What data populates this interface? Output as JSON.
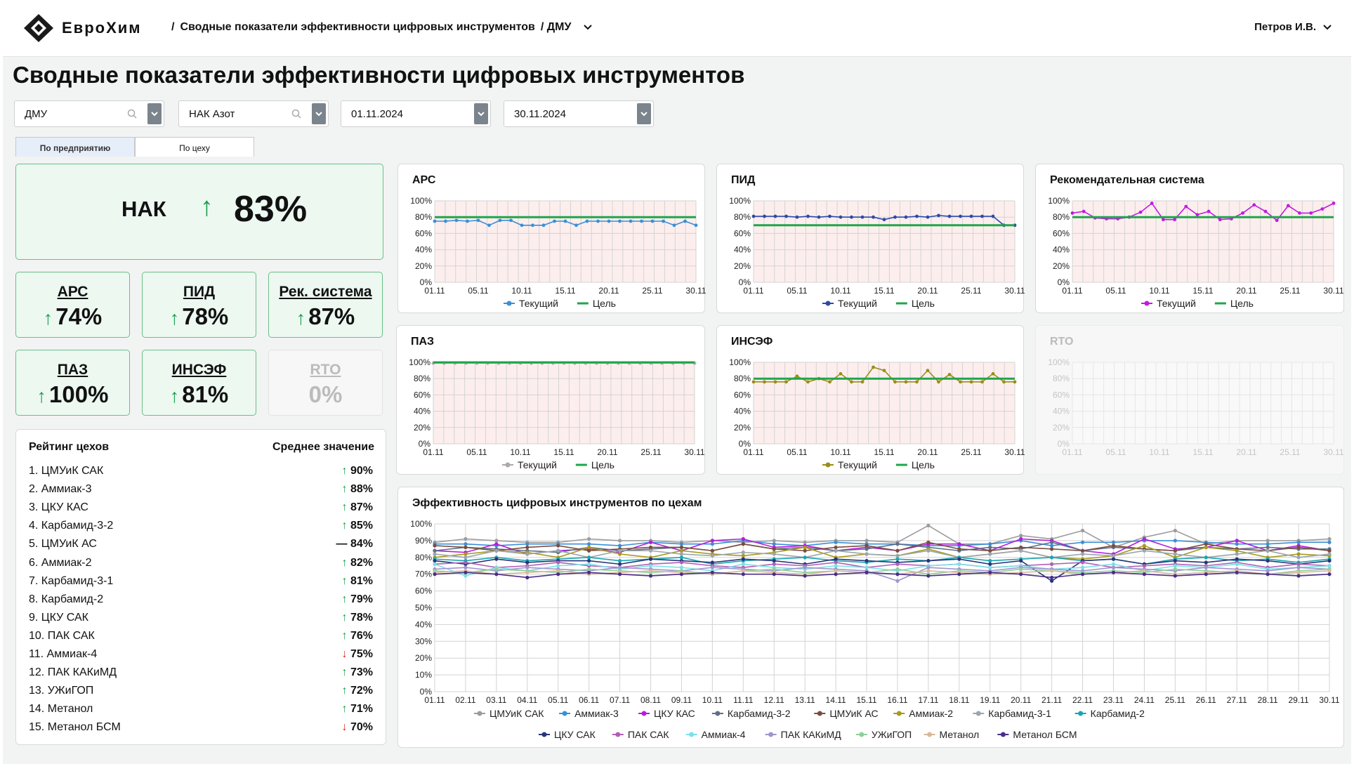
{
  "header": {
    "logo_text": "ЕвроХим",
    "breadcrumb_title": "Сводные показатели эффективности цифровых инструментов",
    "breadcrumb_sub": "/ ДМУ",
    "user": "Петров И.В."
  },
  "page_title": "Сводные показатели эффективности цифровых инструментов",
  "filters": [
    {
      "value": "ДМУ",
      "search": true
    },
    {
      "value": "НАК Азот",
      "search": true
    },
    {
      "value": "01.11.2024",
      "search": false
    },
    {
      "value": "30.11.2024",
      "search": false
    }
  ],
  "tabs": [
    {
      "label": "По предприятию",
      "active": true
    },
    {
      "label": "По цеху",
      "active": false
    }
  ],
  "main_kpi": {
    "label": "НАК",
    "arrow": "↑",
    "value": "83%"
  },
  "kpis": [
    {
      "label": "АРС",
      "arrow": "↑",
      "value": "74%",
      "active": true
    },
    {
      "label": "ПИД",
      "arrow": "↑",
      "value": "78%",
      "active": true
    },
    {
      "label": "Рек. система",
      "arrow": "↑",
      "value": "87%",
      "active": true
    },
    {
      "label": "ПАЗ",
      "arrow": "↑",
      "value": "100%",
      "active": true
    },
    {
      "label": "ИНСЭФ",
      "arrow": "↑",
      "value": "81%",
      "active": true
    },
    {
      "label": "RTO",
      "arrow": "",
      "value": "0%",
      "active": false
    }
  ],
  "rating": {
    "title": "Рейтинг цехов",
    "value_header": "Среднее значение",
    "items": [
      {
        "name": "1. ЦМУиК САК",
        "trend": "up",
        "value": "90%"
      },
      {
        "name": "2. Аммиак-3",
        "trend": "up",
        "value": "88%"
      },
      {
        "name": "3. ЦКУ КАС",
        "trend": "up",
        "value": "87%"
      },
      {
        "name": "4. Карбамид-3-2",
        "trend": "up",
        "value": "85%"
      },
      {
        "name": "5. ЦМУиК АС",
        "trend": "flat",
        "value": "84%"
      },
      {
        "name": "6. Аммиак-2",
        "trend": "up",
        "value": "82%"
      },
      {
        "name": "7. Карбамид-3-1",
        "trend": "up",
        "value": "81%"
      },
      {
        "name": "8. Карбамид-2",
        "trend": "up",
        "value": "79%"
      },
      {
        "name": "9. ЦКУ САК",
        "trend": "up",
        "value": "78%"
      },
      {
        "name": "10. ПАК САК",
        "trend": "up",
        "value": "76%"
      },
      {
        "name": "11. Аммиак-4",
        "trend": "down",
        "value": "75%"
      },
      {
        "name": "12. ПАК КАКиМД",
        "trend": "up",
        "value": "73%"
      },
      {
        "name": "13. УЖиГОП",
        "trend": "up",
        "value": "72%"
      },
      {
        "name": "14. Метанол",
        "trend": "up",
        "value": "71%"
      },
      {
        "name": "15. Метанол БСМ",
        "trend": "down",
        "value": "70%"
      }
    ]
  },
  "colors": {
    "up": "#1a9e4b",
    "down": "#d7261e",
    "target": "#1fa64a",
    "band": "#fdeeee"
  },
  "chart_data": [
    {
      "id": "ars",
      "type": "line",
      "title": "АРС",
      "x": [
        "01.11",
        "05.11",
        "10.11",
        "15.11",
        "20.11",
        "25.11",
        "30.11"
      ],
      "ylim": [
        0,
        100
      ],
      "yticks": [
        "0%",
        "20%",
        "40%",
        "60%",
        "80%",
        "100%"
      ],
      "series": [
        {
          "name": "Текущий",
          "color": "#3b8fd6",
          "values": [
            75,
            75,
            76,
            75,
            76,
            70,
            76,
            76,
            70,
            70,
            70,
            75,
            75,
            70,
            75,
            75,
            75,
            75,
            75,
            75,
            75,
            75,
            70,
            75,
            70
          ]
        },
        {
          "name": "Цель",
          "color": "#1fa64a",
          "values": [
            80,
            80
          ]
        }
      ]
    },
    {
      "id": "pid",
      "type": "line",
      "title": "ПИД",
      "x": [
        "01.11",
        "05.11",
        "10.11",
        "15.11",
        "20.11",
        "25.11",
        "30.11"
      ],
      "ylim": [
        0,
        100
      ],
      "yticks": [
        "0%",
        "20%",
        "40%",
        "60%",
        "80%",
        "100%"
      ],
      "series": [
        {
          "name": "Текущий",
          "color": "#2c4aa8",
          "values": [
            81,
            81,
            81,
            81,
            80,
            81,
            80,
            81,
            80,
            80,
            80,
            80,
            77,
            80,
            80,
            81,
            80,
            82,
            81,
            81,
            81,
            81,
            81,
            70,
            70
          ]
        },
        {
          "name": "Цель",
          "color": "#1fa64a",
          "values": [
            70,
            70
          ]
        }
      ]
    },
    {
      "id": "rec",
      "type": "line",
      "title": "Рекомендательная система",
      "x": [
        "01.11",
        "05.11",
        "10.11",
        "15.11",
        "20.11",
        "25.11",
        "30.11"
      ],
      "ylim": [
        0,
        100
      ],
      "yticks": [
        "0%",
        "20%",
        "40%",
        "60%",
        "80%",
        "100%"
      ],
      "series": [
        {
          "name": "Текущий",
          "color": "#c21be0",
          "values": [
            85,
            87,
            79,
            78,
            78,
            80,
            86,
            97,
            77,
            77,
            93,
            83,
            87,
            77,
            78,
            85,
            95,
            87,
            76,
            94,
            85,
            85,
            90,
            97
          ]
        },
        {
          "name": "Цель",
          "color": "#1fa64a",
          "values": [
            80,
            80
          ]
        }
      ]
    },
    {
      "id": "paz",
      "type": "line",
      "title": "ПАЗ",
      "x": [
        "01.11",
        "05.11",
        "10.11",
        "15.11",
        "20.11",
        "25.11",
        "30.11"
      ],
      "ylim": [
        0,
        100
      ],
      "yticks": [
        "0%",
        "20%",
        "40%",
        "60%",
        "80%",
        "100%"
      ],
      "series": [
        {
          "name": "Текущий",
          "color": "#aaaaaa",
          "values": [
            99,
            99,
            99,
            99,
            99,
            99,
            99,
            99,
            99,
            99,
            99,
            99,
            99,
            99,
            99,
            99,
            99,
            99,
            99,
            99,
            99,
            99,
            99,
            99,
            99
          ]
        },
        {
          "name": "Цель",
          "color": "#1fa64a",
          "values": [
            100,
            100
          ]
        }
      ]
    },
    {
      "id": "insef",
      "type": "line",
      "title": "ИНСЭФ",
      "x": [
        "01.11",
        "05.11",
        "10.11",
        "15.11",
        "20.11",
        "25.11",
        "30.11"
      ],
      "ylim": [
        0,
        100
      ],
      "yticks": [
        "0%",
        "20%",
        "40%",
        "60%",
        "80%",
        "100%"
      ],
      "series": [
        {
          "name": "Текущий",
          "color": "#9b8d17",
          "values": [
            76,
            76,
            76,
            76,
            83,
            76,
            80,
            76,
            86,
            76,
            76,
            94,
            90,
            76,
            76,
            76,
            90,
            76,
            85,
            76,
            76,
            76,
            86,
            76,
            76
          ]
        },
        {
          "name": "Цель",
          "color": "#1fa64a",
          "values": [
            80,
            80
          ]
        }
      ]
    },
    {
      "id": "rto",
      "type": "line",
      "title": "RTO",
      "x": [
        "01.11",
        "05.11",
        "10.11",
        "15.11",
        "20.11",
        "25.11",
        "30.11"
      ],
      "ylim": [
        0,
        100
      ],
      "yticks": [
        "0%",
        "20%",
        "40%",
        "60%",
        "80%",
        "100%"
      ],
      "series": []
    },
    {
      "id": "shops",
      "type": "line",
      "title": "Эффективность цифровых инструментов по цехам",
      "x": [
        "01.11",
        "02.11",
        "03.11",
        "04.11",
        "05.11",
        "06.11",
        "07.11",
        "08.11",
        "09.11",
        "10.11",
        "11.11",
        "12.11",
        "13.11",
        "14.11",
        "15.11",
        "16.11",
        "17.11",
        "18.11",
        "19.11",
        "20.11",
        "21.11",
        "22.11",
        "23.11",
        "24.11",
        "25.11",
        "26.11",
        "27.11",
        "28.11",
        "29.11",
        "30.11"
      ],
      "ylim": [
        0,
        100
      ],
      "yticks": [
        "0%",
        "10%",
        "20%",
        "30%",
        "40%",
        "50%",
        "60%",
        "70%",
        "80%",
        "90%",
        "100%"
      ],
      "series": [
        {
          "name": "ЦМУиК САК",
          "color": "#9c9c9c",
          "values": [
            89,
            91,
            90,
            89,
            89,
            91,
            90,
            90,
            89,
            90,
            89,
            90,
            89,
            90,
            90,
            89,
            99,
            88,
            88,
            93,
            91,
            96,
            86,
            92,
            96,
            88,
            90,
            90,
            90,
            91
          ]
        },
        {
          "name": "Аммиак-3",
          "color": "#3b8fd6",
          "values": [
            88,
            88,
            87,
            88,
            88,
            88,
            87,
            89,
            88,
            88,
            90,
            88,
            87,
            89,
            88,
            88,
            87,
            87,
            88,
            90,
            87,
            89,
            89,
            90,
            90,
            89,
            88,
            88,
            89,
            89
          ]
        },
        {
          "name": "ЦКУ КАС",
          "color": "#b51ce0",
          "values": [
            84,
            83,
            88,
            82,
            84,
            85,
            83,
            89,
            84,
            90,
            91,
            86,
            87,
            84,
            86,
            84,
            88,
            88,
            84,
            91,
            90,
            84,
            82,
            91,
            85,
            86,
            90,
            84,
            87,
            84
          ]
        },
        {
          "name": "Карбамид-3-2",
          "color": "#5f6f86",
          "values": [
            84,
            86,
            85,
            84,
            83,
            86,
            84,
            85,
            86,
            84,
            88,
            85,
            86,
            84,
            85,
            88,
            86,
            84,
            86,
            85,
            89,
            84,
            86,
            85,
            84,
            86,
            85,
            86,
            85,
            85
          ]
        },
        {
          "name": "ЦМУиК АС",
          "color": "#7a4d3f",
          "values": [
            87,
            86,
            84,
            86,
            87,
            84,
            85,
            86,
            86,
            84,
            88,
            85,
            84,
            86,
            87,
            84,
            89,
            85,
            84,
            86,
            85,
            84,
            87,
            85,
            84,
            88,
            85,
            84,
            86,
            84
          ]
        },
        {
          "name": "Аммиак-2",
          "color": "#a89a1e",
          "values": [
            80,
            82,
            84,
            83,
            80,
            86,
            82,
            80,
            84,
            82,
            81,
            83,
            86,
            80,
            82,
            81,
            85,
            80,
            82,
            84,
            80,
            79,
            81,
            87,
            80,
            86,
            84,
            80,
            82,
            81
          ]
        },
        {
          "name": "Карбамид-3-1",
          "color": "#9aa6b0",
          "values": [
            82,
            80,
            84,
            82,
            84,
            80,
            84,
            84,
            82,
            81,
            83,
            82,
            80,
            84,
            82,
            81,
            84,
            80,
            82,
            84,
            80,
            82,
            81,
            84,
            82,
            80,
            82,
            84,
            80,
            82
          ]
        },
        {
          "name": "Карбамид-2",
          "color": "#1aa5b0",
          "values": [
            79,
            78,
            80,
            78,
            79,
            80,
            78,
            79,
            80,
            76,
            78,
            79,
            80,
            78,
            77,
            79,
            78,
            80,
            78,
            79,
            80,
            78,
            79,
            76,
            79,
            80,
            78,
            79,
            77,
            79
          ]
        },
        {
          "name": "ЦКУ САК",
          "color": "#27347a",
          "values": [
            78,
            76,
            79,
            77,
            78,
            78,
            76,
            79,
            78,
            77,
            79,
            78,
            76,
            79,
            78,
            77,
            78,
            79,
            76,
            78,
            66,
            78,
            79,
            76,
            78,
            77,
            79,
            78,
            76,
            78
          ]
        },
        {
          "name": "ПАК САК",
          "color": "#b15fb5",
          "values": [
            76,
            77,
            74,
            75,
            77,
            75,
            74,
            76,
            77,
            75,
            74,
            76,
            75,
            77,
            74,
            76,
            75,
            76,
            74,
            75,
            76,
            77,
            74,
            75,
            76,
            75,
            77,
            74,
            76,
            75
          ]
        },
        {
          "name": "Аммиак-4",
          "color": "#7be0e8",
          "values": [
            76,
            69,
            74,
            72,
            75,
            76,
            73,
            75,
            74,
            72,
            76,
            74,
            73,
            75,
            74,
            72,
            75,
            76,
            74,
            75,
            73,
            74,
            76,
            72,
            75,
            74,
            76,
            73,
            74,
            75
          ]
        },
        {
          "name": "ПАК КАКиМД",
          "color": "#9e95cf",
          "values": [
            73,
            74,
            72,
            74,
            73,
            72,
            74,
            73,
            72,
            74,
            73,
            72,
            74,
            73,
            72,
            66,
            74,
            73,
            72,
            74,
            73,
            72,
            74,
            73,
            72,
            74,
            73,
            72,
            74,
            73
          ]
        },
        {
          "name": "УЖиГОП",
          "color": "#8fcf99",
          "values": [
            72,
            71,
            73,
            72,
            71,
            73,
            72,
            71,
            72,
            70,
            72,
            73,
            71,
            72,
            71,
            73,
            70,
            72,
            71,
            73,
            72,
            71,
            72,
            71,
            73,
            72,
            71,
            70,
            72,
            73
          ]
        },
        {
          "name": "Метанол",
          "color": "#d9b89a",
          "values": [
            71,
            72,
            70,
            71,
            72,
            70,
            71,
            72,
            71,
            70,
            72,
            71,
            70,
            72,
            71,
            70,
            72,
            71,
            70,
            71,
            72,
            70,
            71,
            72,
            70,
            71,
            72,
            70,
            71,
            72
          ]
        },
        {
          "name": "Метанол БСМ",
          "color": "#4a2d8a",
          "values": [
            70,
            71,
            70,
            68,
            70,
            71,
            70,
            69,
            70,
            71,
            70,
            70,
            69,
            70,
            71,
            70,
            69,
            70,
            71,
            70,
            68,
            70,
            71,
            70,
            69,
            70,
            71,
            70,
            69,
            70
          ]
        }
      ]
    }
  ]
}
